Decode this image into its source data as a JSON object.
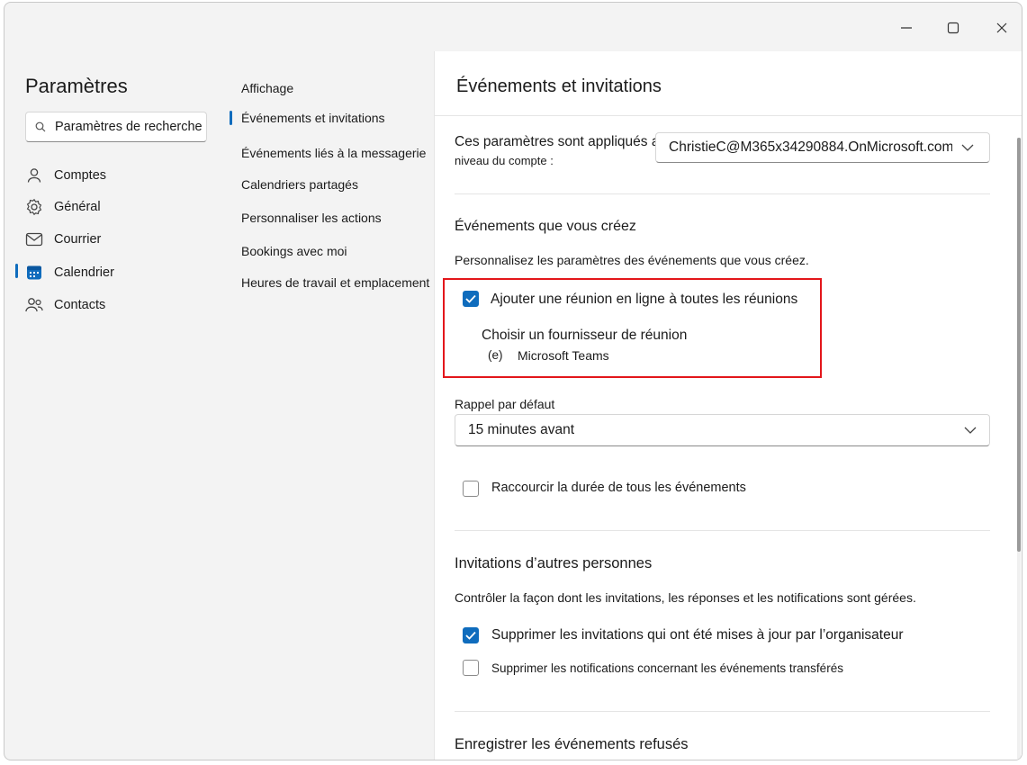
{
  "window": {
    "minimize_label": "Minimize",
    "maximize_label": "Maximize",
    "close_label": "Close"
  },
  "settings": {
    "title": "Paramètres",
    "search_placeholder": "Paramètres de recherche",
    "categories": [
      {
        "label": "Comptes",
        "icon": "person-icon"
      },
      {
        "label": "Général",
        "icon": "gear-icon"
      },
      {
        "label": "Courrier",
        "icon": "mail-icon"
      },
      {
        "label": "Calendrier",
        "icon": "calendar-icon",
        "selected": true
      },
      {
        "label": "Contacts",
        "icon": "people-icon"
      }
    ]
  },
  "nav": {
    "items": [
      {
        "label": "Affichage"
      },
      {
        "label": "Événements et invitations",
        "selected": true
      },
      {
        "label": "Événements liés à la messagerie"
      },
      {
        "label": "Calendriers partagés"
      },
      {
        "label": "Personnaliser les actions"
      },
      {
        "label": "Bookings avec moi"
      },
      {
        "label": "Heures de travail et emplacement"
      }
    ]
  },
  "content": {
    "title": "Événements et invitations",
    "account_label_line1": "Ces paramètres sont appliqués au",
    "account_label_line2": "niveau du compte :",
    "account_value": "ChristieC@M365x34290884.OnMicrosoft.com",
    "section1": {
      "heading": "Événements que vous créez",
      "description": "Personnalisez les paramètres des événements que vous créez.",
      "online_meeting_label": "Ajouter une réunion en ligne à toutes les réunions",
      "online_meeting_checked": true,
      "provider_heading": "Choisir un fournisseur de réunion",
      "provider_radio_glyph": "(e)",
      "provider_value": "Microsoft Teams",
      "reminder_label": "Rappel par défaut",
      "reminder_value": "15 minutes avant",
      "shorten_label": "Raccourcir la durée de tous les événements",
      "shorten_checked": false
    },
    "section2": {
      "heading": "Invitations d’autres personnes",
      "description": "Contrôler la façon dont les invitations, les réponses et les notifications sont gérées.",
      "delete_updated_label": "Supprimer les invitations qui ont été mises à jour par l’organisateur",
      "delete_updated_checked": true,
      "delete_forward_label": "Supprimer les notifications concernant les événements transférés",
      "delete_forward_checked": false
    },
    "section3": {
      "heading": "Enregistrer les événements refusés"
    }
  },
  "colors": {
    "accent": "#0f6cbd",
    "highlight_border": "#e3161b",
    "window_bg": "#f3f3f3",
    "content_bg": "#ffffff"
  }
}
